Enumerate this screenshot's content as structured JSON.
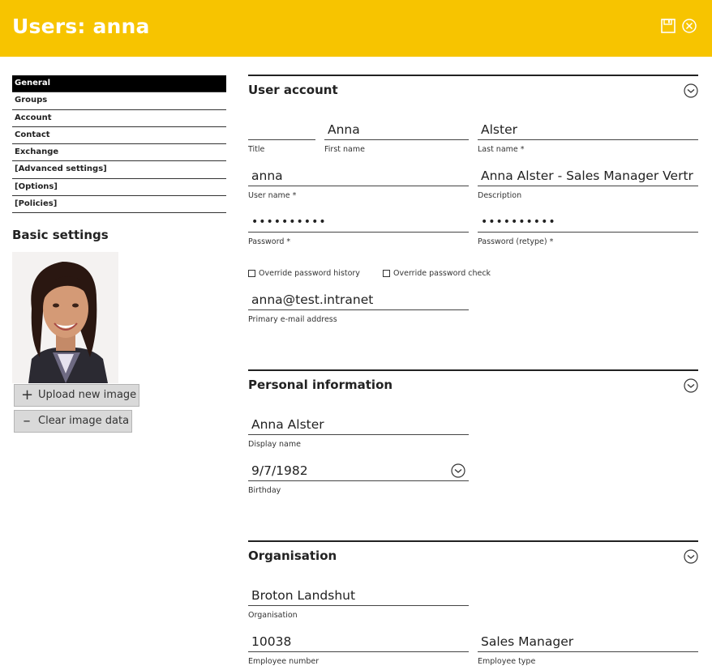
{
  "header": {
    "title": "Users: anna"
  },
  "icons": {
    "save": "save-icon",
    "close": "close-icon",
    "expand": "chevron-down-circle-icon"
  },
  "colors": {
    "header_bg": "#f7c400",
    "nav_active_bg": "#000000"
  },
  "sidebar": {
    "items": [
      {
        "label": "General",
        "active": true
      },
      {
        "label": "Groups"
      },
      {
        "label": "Account"
      },
      {
        "label": "Contact"
      },
      {
        "label": "Exchange"
      },
      {
        "label": "[Advanced settings]"
      },
      {
        "label": "[Options]"
      },
      {
        "label": "[Policies]"
      }
    ],
    "heading": "Basic settings",
    "upload_label": "Upload new image",
    "clear_label": "Clear image data"
  },
  "sections": {
    "user_account": {
      "title": "User account",
      "title_field": {
        "label": "Title",
        "value": ""
      },
      "first_name": {
        "label": "First name",
        "value": "Anna"
      },
      "last_name": {
        "label": "Last name *",
        "value": "Alster"
      },
      "user_name": {
        "label": "User name *",
        "value": "anna"
      },
      "description": {
        "label": "Description",
        "value": "Anna Alster - Sales Manager Vertr"
      },
      "password": {
        "label": "Password *",
        "value": "••••••••••"
      },
      "password_retype": {
        "label": "Password (retype) *",
        "value": "••••••••••"
      },
      "override_history": "Override password history",
      "override_check": "Override password check",
      "email": {
        "label": "Primary e-mail address",
        "value": "anna@test.intranet"
      }
    },
    "personal": {
      "title": "Personal information",
      "display_name": {
        "label": "Display name",
        "value": "Anna Alster"
      },
      "birthday": {
        "label": "Birthday",
        "value": "9/7/1982"
      }
    },
    "organisation": {
      "title": "Organisation",
      "organisation": {
        "label": "Organisation",
        "value": "Broton Landshut"
      },
      "employee_number": {
        "label": "Employee number",
        "value": "10038"
      },
      "employee_type": {
        "label": "Employee type",
        "value": "Sales Manager"
      }
    }
  }
}
